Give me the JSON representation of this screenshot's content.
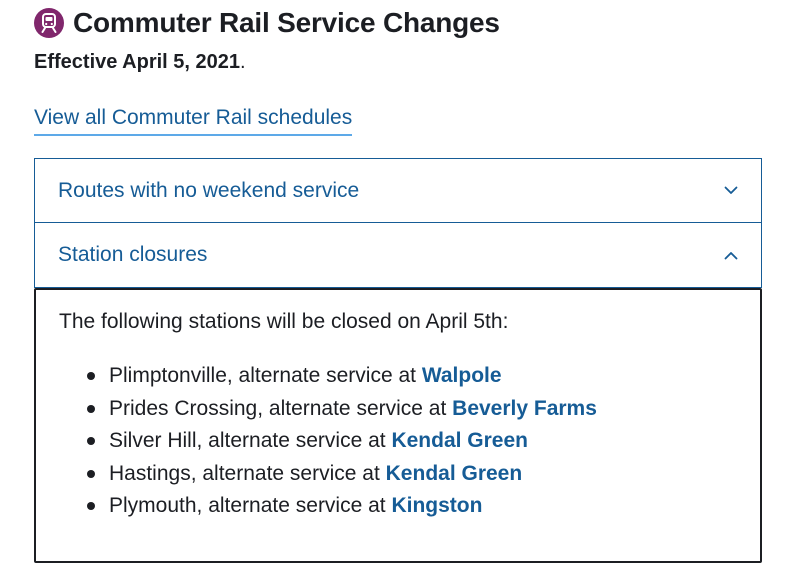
{
  "header": {
    "title": "Commuter Rail Service Changes",
    "icon": "commuter-rail-train-icon",
    "icon_color": "#80276c",
    "effective_label": "Effective April 5, 2021",
    "effective_period": "."
  },
  "schedules_link": {
    "label": "View all Commuter Rail schedules"
  },
  "accordion": {
    "items": [
      {
        "label": "Routes with no weekend service",
        "expanded": false,
        "icon": "chevron-down-icon"
      },
      {
        "label": "Station closures",
        "expanded": true,
        "icon": "chevron-up-icon"
      }
    ]
  },
  "closures": {
    "intro": "The following stations will be closed on April 5th:",
    "items": [
      {
        "text": "Plimptonville, alternate service at ",
        "link": "Walpole"
      },
      {
        "text": "Prides Crossing, alternate service at ",
        "link": "Beverly Farms"
      },
      {
        "text": "Silver Hill, alternate service at ",
        "link": "Kendal Green"
      },
      {
        "text": "Hastings, alternate service at ",
        "link": "Kendal Green"
      },
      {
        "text": "Plymouth, alternate service at ",
        "link": "Kingston"
      }
    ]
  },
  "colors": {
    "link": "#165c96",
    "text": "#1c1e23",
    "commuter_rail": "#80276c"
  }
}
